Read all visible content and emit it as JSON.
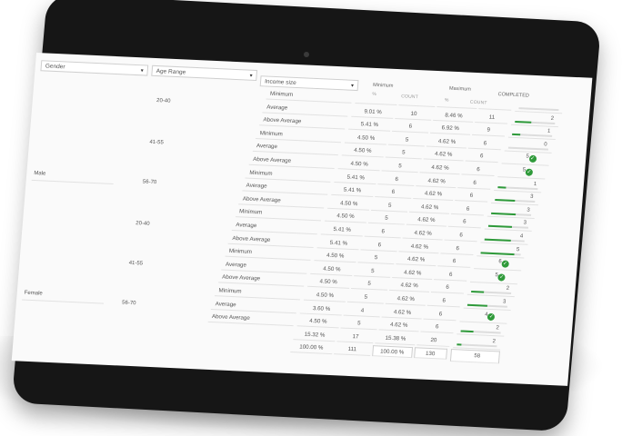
{
  "filters": {
    "gender": "Gender",
    "age_range": "Age Range",
    "income_size": "Income size"
  },
  "headers": {
    "minimum": "Minimum",
    "maximum": "Maximum",
    "completed": "COMPLETED",
    "pct": "%",
    "count": "COUNT"
  },
  "groups": {
    "male": "Male",
    "female": "Female",
    "age_20_40": "20-40",
    "age_41_55": "41-55",
    "age_56_70": "56-70"
  },
  "rows": [
    {
      "label": "Minimum",
      "min_pct": "",
      "min_count": "",
      "max_pct": "",
      "max_count": "",
      "completed": "",
      "progress": 0,
      "done": false
    },
    {
      "label": "Average",
      "min_pct": "9.01 %",
      "min_count": "10",
      "max_pct": "8.46 %",
      "max_count": "11",
      "completed": "2",
      "progress": 0.4,
      "done": false
    },
    {
      "label": "Above Average",
      "min_pct": "5.41 %",
      "min_count": "6",
      "max_pct": "6.92 %",
      "max_count": "9",
      "completed": "1",
      "progress": 0.2,
      "done": false
    },
    {
      "label": "Minimum",
      "min_pct": "4.50 %",
      "min_count": "5",
      "max_pct": "4.62 %",
      "max_count": "6",
      "completed": "0",
      "progress": 0,
      "done": false
    },
    {
      "label": "Average",
      "min_pct": "4.50 %",
      "min_count": "5",
      "max_pct": "4.62 %",
      "max_count": "6",
      "completed": "5",
      "progress": 1,
      "done": true
    },
    {
      "label": "Above Average",
      "min_pct": "4.50 %",
      "min_count": "5",
      "max_pct": "4.62 %",
      "max_count": "6",
      "completed": "5",
      "progress": 1,
      "done": true
    },
    {
      "label": "Minimum",
      "min_pct": "5.41 %",
      "min_count": "6",
      "max_pct": "4.62 %",
      "max_count": "6",
      "completed": "1",
      "progress": 0.2,
      "done": false
    },
    {
      "label": "Average",
      "min_pct": "5.41 %",
      "min_count": "6",
      "max_pct": "4.62 %",
      "max_count": "6",
      "completed": "3",
      "progress": 0.5,
      "done": false
    },
    {
      "label": "Above Average",
      "min_pct": "4.50 %",
      "min_count": "5",
      "max_pct": "4.62 %",
      "max_count": "6",
      "completed": "3",
      "progress": 0.6,
      "done": false
    },
    {
      "label": "Minimum",
      "min_pct": "4.50 %",
      "min_count": "5",
      "max_pct": "4.62 %",
      "max_count": "6",
      "completed": "3",
      "progress": 0.6,
      "done": false
    },
    {
      "label": "Average",
      "min_pct": "5.41 %",
      "min_count": "6",
      "max_pct": "4.62 %",
      "max_count": "6",
      "completed": "4",
      "progress": 0.67,
      "done": false
    },
    {
      "label": "Above Average",
      "min_pct": "5.41 %",
      "min_count": "6",
      "max_pct": "4.62 %",
      "max_count": "6",
      "completed": "5",
      "progress": 0.83,
      "done": false
    },
    {
      "label": "Minimum",
      "min_pct": "4.50 %",
      "min_count": "5",
      "max_pct": "4.62 %",
      "max_count": "6",
      "completed": "6",
      "progress": 1,
      "done": true
    },
    {
      "label": "Average",
      "min_pct": "4.50 %",
      "min_count": "5",
      "max_pct": "4.62 %",
      "max_count": "6",
      "completed": "5",
      "progress": 1,
      "done": true
    },
    {
      "label": "Above Average",
      "min_pct": "4.50 %",
      "min_count": "5",
      "max_pct": "4.62 %",
      "max_count": "6",
      "completed": "2",
      "progress": 0.33,
      "done": false
    },
    {
      "label": "Minimum",
      "min_pct": "4.50 %",
      "min_count": "5",
      "max_pct": "4.62 %",
      "max_count": "6",
      "completed": "3",
      "progress": 0.5,
      "done": false
    },
    {
      "label": "Average",
      "min_pct": "3.60 %",
      "min_count": "4",
      "max_pct": "4.62 %",
      "max_count": "6",
      "completed": "4",
      "progress": 1,
      "done": true
    },
    {
      "label": "Above Average",
      "min_pct": "4.50 %",
      "min_count": "5",
      "max_pct": "4.62 %",
      "max_count": "6",
      "completed": "2",
      "progress": 0.33,
      "done": false
    }
  ],
  "summary": [
    {
      "min_pct": "15.32 %",
      "min_count": "17",
      "max_pct": "15.38 %",
      "max_count": "20",
      "completed": "2",
      "progress": 0.1
    },
    {
      "min_pct": "100.00 %",
      "min_count": "111",
      "max_pct": "100.00 %",
      "max_count": "130",
      "completed": "58",
      "progress": 0
    }
  ],
  "colors": {
    "progress": "#2e9a3a",
    "check": "#2f9a3a"
  }
}
